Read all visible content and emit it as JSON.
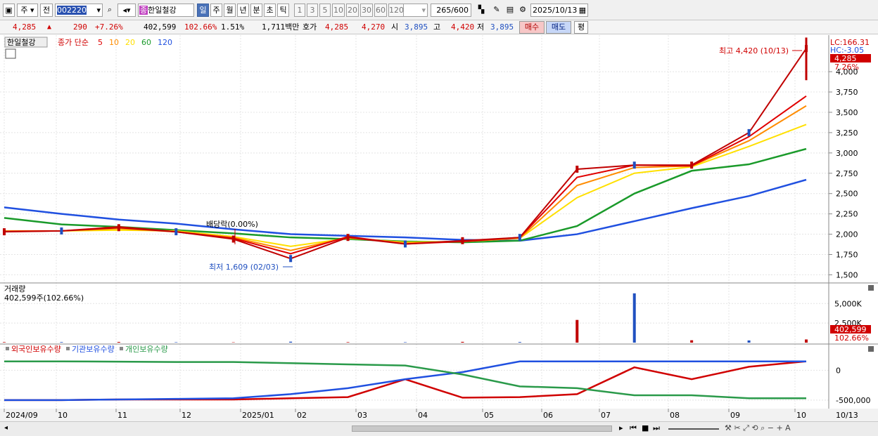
{
  "toolbar": {
    "type_sel": "주",
    "prev_label": "전",
    "code": "002220",
    "name_badge": "종",
    "name": "한일철강",
    "periods": [
      "일",
      "주",
      "월",
      "년",
      "분",
      "초",
      "틱"
    ],
    "ticks": [
      "1",
      "3",
      "5",
      "10",
      "20",
      "30",
      "60",
      "120"
    ],
    "count": "265",
    "count_max": "/600",
    "date": "2025/10/13"
  },
  "quote": {
    "price": "4,285",
    "arrow": "▲",
    "change": "290",
    "pct": "+7.26%",
    "volume": "402,599",
    "vol_ratio": "102.66%",
    "turnover": "1.51%",
    "amount": "1,711백만",
    "hoga_label": "호가",
    "ask": "4,285",
    "bid": "4,270",
    "open_label": "시",
    "open": "3,895",
    "high_label": "고",
    "high": "4,420",
    "low_label": "저",
    "low": "3,895",
    "buy_label": "매수",
    "sell_label": "매도",
    "eval_label": "평"
  },
  "price_panel": {
    "name_tag": "한일철강",
    "legend_prefix": "종가 단순",
    "ma_periods": [
      "5",
      "10",
      "20",
      "60",
      "120"
    ],
    "ma_colors": [
      "#e00000",
      "#ff8c00",
      "#ffe000",
      "#1a9a2a",
      "#2050e0"
    ],
    "lc": "LC:166.31",
    "hc": "HC:-3.05",
    "last_price": "4,285",
    "last_pct": "7.26%",
    "high_note": "최고 4,420 (10/13)",
    "low_note": "최저 1,609 (02/03)",
    "div_note": "배당락(0.00%)",
    "yticks": [
      "4,000",
      "3,750",
      "3,500",
      "3,250",
      "3,000",
      "2,750",
      "2,500",
      "2,250",
      "2,000",
      "1,750",
      "1,500"
    ]
  },
  "volume_panel": {
    "title": "거래량",
    "value": "402,599주(102.66%)",
    "yticks": [
      "5,000K",
      "2,500K"
    ],
    "last_value": "402,599",
    "last_pct": "102.66%"
  },
  "holder_panel": {
    "legend": [
      "외국인보유수량",
      "기관보유수량",
      "개인보유수량"
    ],
    "colors": [
      "#d00000",
      "#2050e0",
      "#2a9a4a"
    ],
    "yticks": [
      "0",
      "-500,000"
    ]
  },
  "xaxis": {
    "labels": [
      "2024/09",
      "10",
      "11",
      "12",
      "2025/01",
      "02",
      "03",
      "04",
      "05",
      "06",
      "07",
      "08",
      "09",
      "10"
    ],
    "last": "10/13"
  },
  "chart_data": {
    "type": "line",
    "x": [
      "2024/09",
      "10",
      "11",
      "12",
      "2025/01",
      "02",
      "03",
      "04",
      "05",
      "06",
      "07",
      "08",
      "09",
      "10",
      "10/13"
    ],
    "series": [
      {
        "name": "종가",
        "values": [
          2030,
          2040,
          2080,
          2030,
          1940,
          1700,
          1960,
          1880,
          1920,
          1960,
          2800,
          2850,
          2850,
          3250,
          4285
        ]
      },
      {
        "name": "5",
        "values": [
          2035,
          2040,
          2090,
          2030,
          1950,
          1760,
          1970,
          1880,
          1910,
          1960,
          2700,
          2850,
          2840,
          3200,
          3700
        ]
      },
      {
        "name": "10",
        "values": [
          2035,
          2040,
          2070,
          2030,
          1960,
          1800,
          1960,
          1890,
          1910,
          1950,
          2600,
          2820,
          2840,
          3150,
          3580
        ]
      },
      {
        "name": "20",
        "values": [
          2040,
          2040,
          2050,
          2040,
          1970,
          1850,
          1950,
          1900,
          1910,
          1950,
          2450,
          2750,
          2830,
          3080,
          3350
        ]
      },
      {
        "name": "60",
        "values": [
          2200,
          2120,
          2090,
          2050,
          2010,
          1960,
          1940,
          1910,
          1900,
          1920,
          2100,
          2500,
          2780,
          2860,
          3050
        ]
      },
      {
        "name": "120",
        "values": [
          2330,
          2250,
          2180,
          2130,
          2060,
          2000,
          1980,
          1960,
          1930,
          1920,
          2000,
          2160,
          2320,
          2470,
          2670
        ]
      }
    ],
    "volume_k": [
      60,
      70,
      90,
      50,
      40,
      120,
      60,
      50,
      100,
      80,
      2900,
      6300,
      300,
      280,
      402.599
    ],
    "volume_label": "거래량",
    "holdings": [
      {
        "name": "외국인보유수량",
        "values": [
          -500000,
          -500000,
          -490000,
          -490000,
          -490000,
          -470000,
          -450000,
          -150000,
          -460000,
          -450000,
          -400000,
          50000,
          -150000,
          60000,
          150000
        ]
      },
      {
        "name": "기관보유수량",
        "values": [
          -500000,
          -500000,
          -490000,
          -480000,
          -470000,
          -400000,
          -300000,
          -150000,
          -30000,
          150000,
          150000,
          150000,
          150000,
          150000,
          150000
        ]
      },
      {
        "name": "개인보유수량",
        "values": [
          150000,
          150000,
          145000,
          140000,
          140000,
          120000,
          100000,
          80000,
          -70000,
          -270000,
          -300000,
          -420000,
          -420000,
          -470000,
          -470000
        ]
      }
    ],
    "ylim": [
      1500,
      4420
    ],
    "grid": true,
    "legend": "top-left"
  }
}
